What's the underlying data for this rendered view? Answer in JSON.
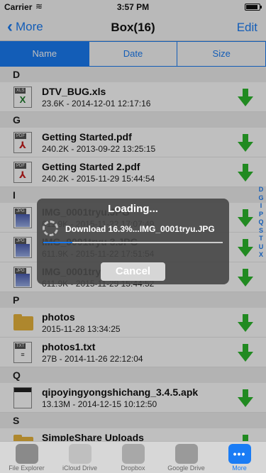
{
  "status_bar": {
    "carrier": "Carrier",
    "time": "3:57 PM",
    "battery_pct": 0.9
  },
  "nav": {
    "back_label": "More",
    "title": "Box(16)",
    "edit_label": "Edit"
  },
  "sort_tabs": [
    {
      "label": "Name",
      "active": true
    },
    {
      "label": "Date",
      "active": false
    },
    {
      "label": "Size",
      "active": false
    }
  ],
  "sections": [
    {
      "letter": "D",
      "rows": [
        {
          "type": "xls",
          "tag": "XLS",
          "name": "DTV_BUG.xls",
          "meta": "23.6K - 2014-12-01 12:17:16"
        }
      ]
    },
    {
      "letter": "G",
      "rows": [
        {
          "type": "pdf",
          "tag": "PDF",
          "name": "Getting Started.pdf",
          "meta": "240.2K - 2013-09-22 13:25:15"
        },
        {
          "type": "pdf",
          "tag": "PDF",
          "name": "Getting Started 2.pdf",
          "meta": "240.2K - 2015-11-29 15:44:54"
        }
      ]
    },
    {
      "letter": "I",
      "rows": [
        {
          "type": "jpg",
          "tag": "JPG",
          "name": "IMG_0001tryu.JPG",
          "meta": "611.9K - 2015-11-22 17:07:49"
        },
        {
          "type": "jpg",
          "tag": "JPG",
          "name": "IMG_0001tryu 3.JPG",
          "meta": "611.9K - 2015-11-22 17:51:54"
        },
        {
          "type": "jpg",
          "tag": "JPG",
          "name": "IMG_0001tryu 2.JPG",
          "meta": "611.9K - 2015-11-29 15:44:52"
        }
      ]
    },
    {
      "letter": "P",
      "rows": [
        {
          "type": "folder",
          "tag": "",
          "name": "photos",
          "meta": "2015-11-28 13:34:25"
        },
        {
          "type": "txt",
          "tag": "TXT",
          "name": "photos1.txt",
          "meta": "27B - 2014-11-26 22:12:04"
        }
      ]
    },
    {
      "letter": "Q",
      "rows": [
        {
          "type": "apk",
          "tag": "",
          "name": "qipoyingyongshichang_3.4.5.apk",
          "meta": "13.13M - 2014-12-15 10:12:50"
        }
      ]
    },
    {
      "letter": "S",
      "rows": [
        {
          "type": "folder",
          "tag": "",
          "name": "SimpleShare Uploads",
          "meta": ""
        }
      ]
    }
  ],
  "index_letters": [
    "D",
    "G",
    "I",
    "P",
    "Q",
    "S",
    "T",
    "U",
    "X"
  ],
  "loading": {
    "title": "Loading...",
    "message": "Download 16.3%...IMG_0001tryu.JPG",
    "progress": 0.163,
    "cancel_label": "Cancel"
  },
  "tabs": [
    {
      "label": "File Explorer",
      "icon": "gear-folder-icon",
      "active": false
    },
    {
      "label": "iCloud Drive",
      "icon": "cloud-icon",
      "active": false
    },
    {
      "label": "Dropbox",
      "icon": "dropbox-icon",
      "active": false
    },
    {
      "label": "Google Drive",
      "icon": "google-drive-icon",
      "active": false
    },
    {
      "label": "More",
      "icon": "more-icon",
      "active": true
    }
  ],
  "colors": {
    "accent": "#1a7cf5",
    "download_green": "#2db82d"
  }
}
